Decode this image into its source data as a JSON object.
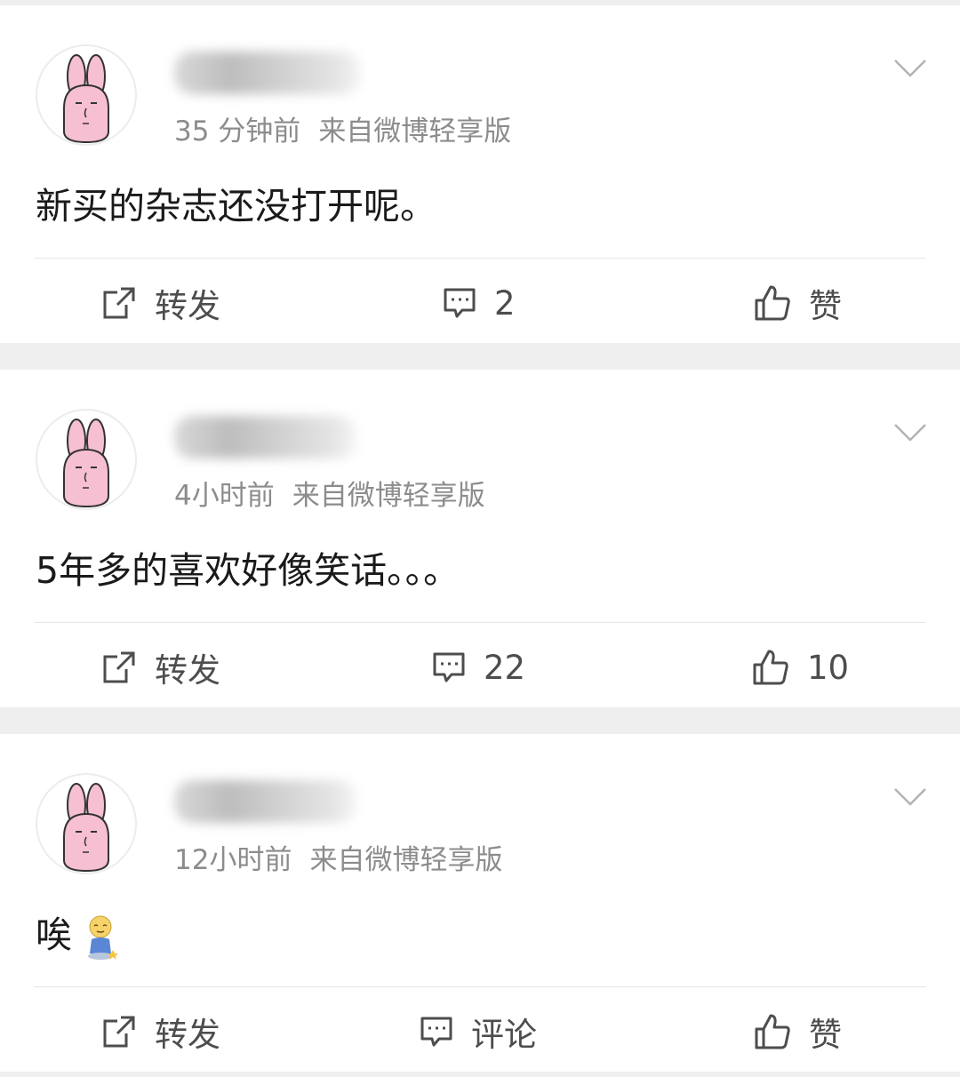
{
  "posts": [
    {
      "time": "35 分钟前",
      "source": "来自微博轻享版",
      "text": "新买的杂志还没打开呢。",
      "repost_label": "转发",
      "comment_label": "2",
      "like_label": "赞"
    },
    {
      "time": "4小时前",
      "source": "来自微博轻享版",
      "text": "5年多的喜欢好像笑话。。。",
      "repost_label": "转发",
      "comment_label": "22",
      "like_label": "10"
    },
    {
      "time": "12小时前",
      "source": "来自微博轻享版",
      "text": "唉",
      "emoji": "sigh-figure-emoji",
      "repost_label": "转发",
      "comment_label": "评论",
      "like_label": "赞"
    }
  ],
  "icons": {
    "avatar": "pink-bunny-avatar",
    "menu": "chevron-down-icon",
    "repost": "repost-icon",
    "comment": "comment-icon",
    "like": "thumbs-up-icon"
  },
  "colors": {
    "avatar_pink": "#f7bfd2",
    "text_gray": "#8c8c8c",
    "action_gray": "#4d4d4d"
  }
}
